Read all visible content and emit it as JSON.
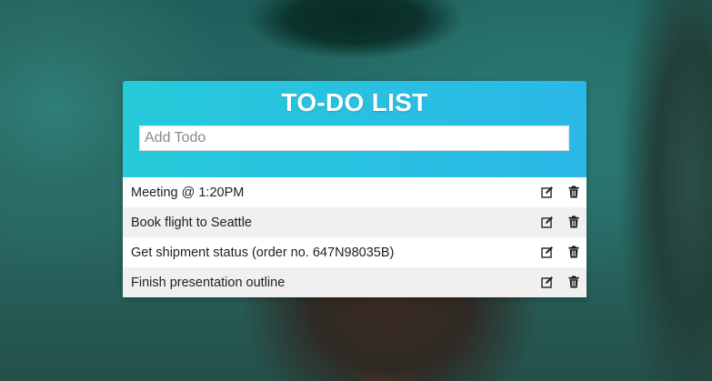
{
  "app": {
    "title": "TO-DO LIST",
    "add_placeholder": "Add Todo",
    "add_value": ""
  },
  "todos": [
    {
      "text": "Meeting @ 1:20PM",
      "edit_icon": "edit-icon",
      "delete_icon": "trash-icon"
    },
    {
      "text": "Book flight to Seattle",
      "edit_icon": "edit-icon",
      "delete_icon": "trash-icon"
    },
    {
      "text": "Get shipment status (order no. 647N98035B)",
      "edit_icon": "edit-icon",
      "delete_icon": "trash-icon"
    },
    {
      "text": "Finish presentation outline",
      "edit_icon": "edit-icon",
      "delete_icon": "trash-icon"
    }
  ],
  "colors": {
    "header_gradient_start": "#26cad9",
    "header_gradient_end": "#2bb8e8",
    "row_alt": "#f0f0f0",
    "row": "#ffffff"
  }
}
